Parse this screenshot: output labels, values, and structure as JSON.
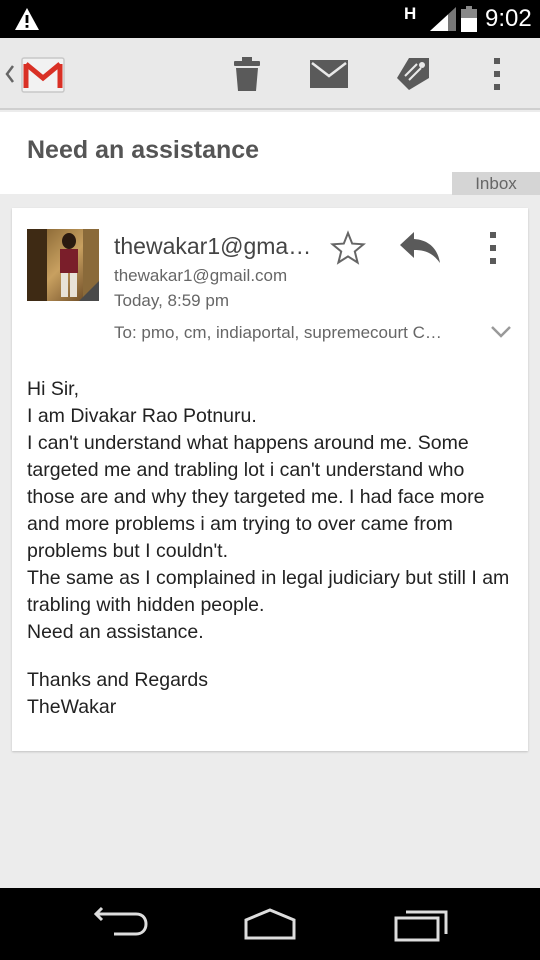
{
  "status_bar": {
    "network_type": "H",
    "time": "9:02"
  },
  "action_bar": {
    "app_icon": "gmail-icon",
    "actions": [
      "delete-icon",
      "mark-unread-icon",
      "label-icon",
      "more-icon"
    ]
  },
  "email": {
    "subject": "Need an assistance",
    "folder_label": "Inbox",
    "sender_name": "thewakar1@gma…",
    "sender_email": "thewakar1@gmail.com",
    "sent_time": "Today, 8:59 pm",
    "recipients": "To: pmo, cm, indiaportal, supremecourt   C…",
    "body_lines": [
      "Hi Sir,",
      "I am Divakar Rao Potnuru.",
      "I can't understand what happens around me. Some targeted me and trabling lot i can't understand who those are and why they targeted me. I had face more and more problems i am trying to over came from problems but I couldn't.",
      "The same as I complained in legal judiciary but still I am trabling with hidden people.",
      "Need an assistance."
    ],
    "signature_lines": [
      "Thanks and Regards",
      "TheWakar"
    ]
  },
  "colors": {
    "action_bar_bg": "#e9e9e9",
    "gmail_red": "#d93025",
    "icon_gray": "#5a5a5a"
  }
}
